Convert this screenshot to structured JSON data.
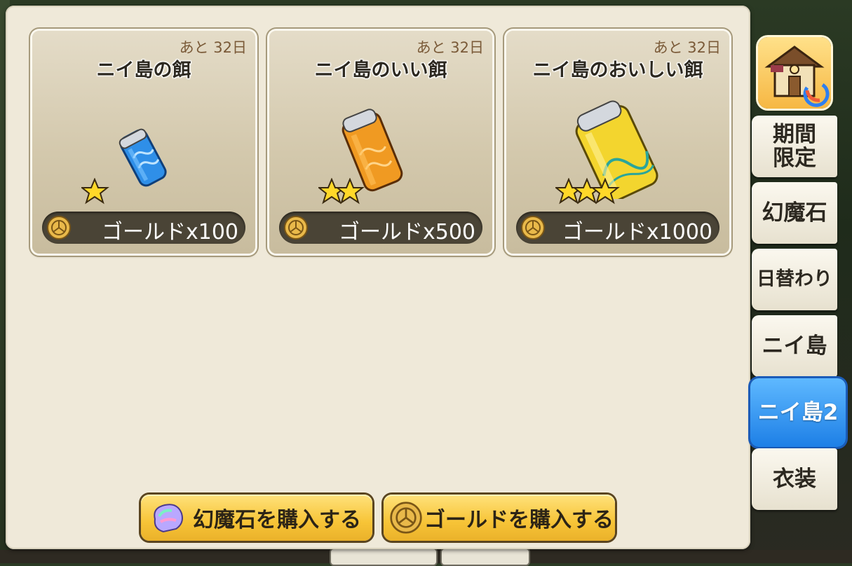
{
  "cards": [
    {
      "remaining": "あと 32日",
      "name": "ニイ島の餌",
      "stars": 1,
      "price": "ゴールドx100",
      "color": "#2f8fe8",
      "icon": "bait-can-blue-icon"
    },
    {
      "remaining": "あと 32日",
      "name": "ニイ島のいい餌",
      "stars": 2,
      "price": "ゴールドx500",
      "color": "#f09a22",
      "icon": "bait-can-orange-icon"
    },
    {
      "remaining": "あと 32日",
      "name": "ニイ島のおいしい餌",
      "stars": 3,
      "price": "ゴールドx1000",
      "color": "#f3d52e",
      "icon": "bait-can-yellow-icon"
    }
  ],
  "tabs": [
    {
      "label": "期間\n限定"
    },
    {
      "label": "幻魔石"
    },
    {
      "label": "日替わり"
    },
    {
      "label": "ニイ島"
    },
    {
      "label": "ニイ島2",
      "active": true
    },
    {
      "label": "衣装"
    }
  ],
  "buttons": {
    "gem_label": "幻魔石を購入する",
    "gold_label": "ゴールドを購入する"
  },
  "colors": {
    "active_tab": "#2a8af0",
    "buy_button": "#f7c437",
    "panel": "#efe9d9"
  }
}
